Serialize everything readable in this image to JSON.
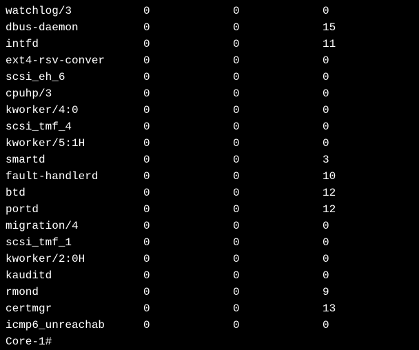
{
  "rows": [
    {
      "name": "watchlog/3",
      "c1": "0",
      "c2": "0",
      "c3": "0"
    },
    {
      "name": "dbus-daemon",
      "c1": "0",
      "c2": "0",
      "c3": "15"
    },
    {
      "name": "intfd",
      "c1": "0",
      "c2": "0",
      "c3": "11"
    },
    {
      "name": "ext4-rsv-conver",
      "c1": "0",
      "c2": "0",
      "c3": "0"
    },
    {
      "name": "scsi_eh_6",
      "c1": "0",
      "c2": "0",
      "c3": "0"
    },
    {
      "name": "cpuhp/3",
      "c1": "0",
      "c2": "0",
      "c3": "0"
    },
    {
      "name": "kworker/4:0",
      "c1": "0",
      "c2": "0",
      "c3": "0"
    },
    {
      "name": "scsi_tmf_4",
      "c1": "0",
      "c2": "0",
      "c3": "0"
    },
    {
      "name": "kworker/5:1H",
      "c1": "0",
      "c2": "0",
      "c3": "0"
    },
    {
      "name": "smartd",
      "c1": "0",
      "c2": "0",
      "c3": "3"
    },
    {
      "name": "fault-handlerd",
      "c1": "0",
      "c2": "0",
      "c3": "10"
    },
    {
      "name": "btd",
      "c1": "0",
      "c2": "0",
      "c3": "12"
    },
    {
      "name": "portd",
      "c1": "0",
      "c2": "0",
      "c3": "12"
    },
    {
      "name": "migration/4",
      "c1": "0",
      "c2": "0",
      "c3": "0"
    },
    {
      "name": "scsi_tmf_1",
      "c1": "0",
      "c2": "0",
      "c3": "0"
    },
    {
      "name": "kworker/2:0H",
      "c1": "0",
      "c2": "0",
      "c3": "0"
    },
    {
      "name": "kauditd",
      "c1": "0",
      "c2": "0",
      "c3": "0"
    },
    {
      "name": "rmond",
      "c1": "0",
      "c2": "0",
      "c3": "9"
    },
    {
      "name": "certmgr",
      "c1": "0",
      "c2": "0",
      "c3": "13"
    },
    {
      "name": "icmp6_unreachab",
      "c1": "0",
      "c2": "0",
      "c3": "0"
    }
  ],
  "prompt": "Core-1#"
}
